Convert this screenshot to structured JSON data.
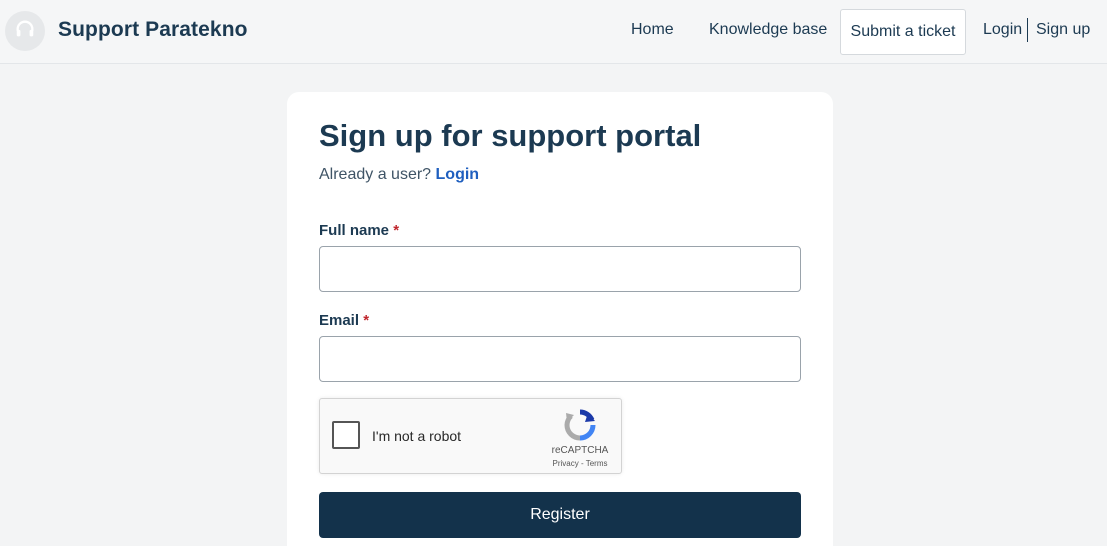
{
  "header": {
    "logo_icon": "headset-icon",
    "brand": "Support Paratekno",
    "nav": {
      "home": "Home",
      "knowledge_base": "Knowledge base",
      "submit_ticket": "Submit a ticket",
      "login": "Login",
      "signup": "Sign up"
    }
  },
  "form": {
    "title": "Sign up for support portal",
    "already_prefix": "Already a user?",
    "login_link": "Login",
    "full_name_label": "Full name",
    "email_label": "Email",
    "required_mark": "*",
    "full_name_value": "",
    "email_value": "",
    "captcha": {
      "label": "I'm not a robot",
      "brand": "reCAPTCHA",
      "links": "Privacy - Terms",
      "checked": false
    },
    "register_label": "Register"
  },
  "colors": {
    "brand_text": "#1c3a52",
    "link": "#1f5fbf",
    "required": "#c0262d",
    "button_bg": "#13324b"
  }
}
